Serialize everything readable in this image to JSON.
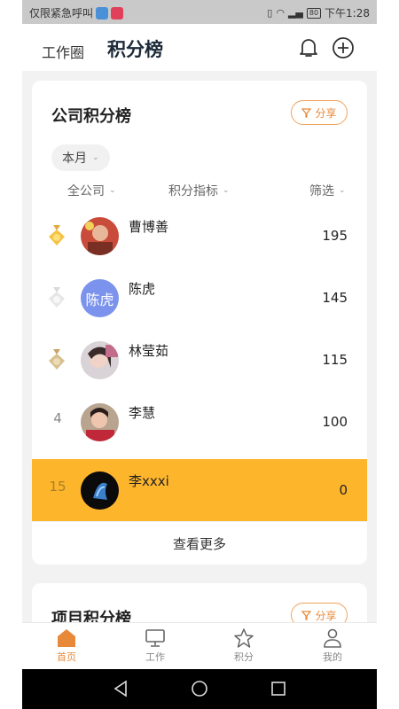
{
  "status_bar": {
    "carrier_text": "仅限紧急呼叫",
    "battery": "80",
    "time": "下午1:28"
  },
  "header": {
    "tab_inactive": "工作圈",
    "tab_active": "积分榜"
  },
  "company_board": {
    "title": "公司积分榜",
    "share_label": "分享",
    "period_chip": "本月",
    "filters": [
      "全公司",
      "积分指标",
      "筛选"
    ],
    "rows": [
      {
        "rank": "1",
        "medal": "gold",
        "name": "曹博善",
        "avatar_text": "",
        "score": "195"
      },
      {
        "rank": "2",
        "medal": "silver",
        "name": "陈虎",
        "avatar_text": "陈虎",
        "score": "145"
      },
      {
        "rank": "3",
        "medal": "bronze",
        "name": "林莹茹",
        "avatar_text": "",
        "score": "115"
      },
      {
        "rank": "4",
        "medal": "",
        "name": "李慧",
        "avatar_text": "",
        "score": "100"
      },
      {
        "rank": "15",
        "medal": "",
        "name": "李xxxi",
        "avatar_text": "",
        "score": "0"
      }
    ],
    "more_label": "查看更多"
  },
  "project_board": {
    "title": "项目积分榜",
    "share_label": "分享"
  },
  "tabbar": {
    "items": [
      {
        "label": "首页",
        "icon": "home-icon",
        "active": true
      },
      {
        "label": "工作",
        "icon": "monitor-icon",
        "active": false
      },
      {
        "label": "积分",
        "icon": "star-icon",
        "active": false
      },
      {
        "label": "我的",
        "icon": "person-icon",
        "active": false
      }
    ]
  },
  "colors": {
    "accent": "#e8893a",
    "highlight_row": "#fdb52c",
    "avatar_blue": "#7b93ec"
  }
}
